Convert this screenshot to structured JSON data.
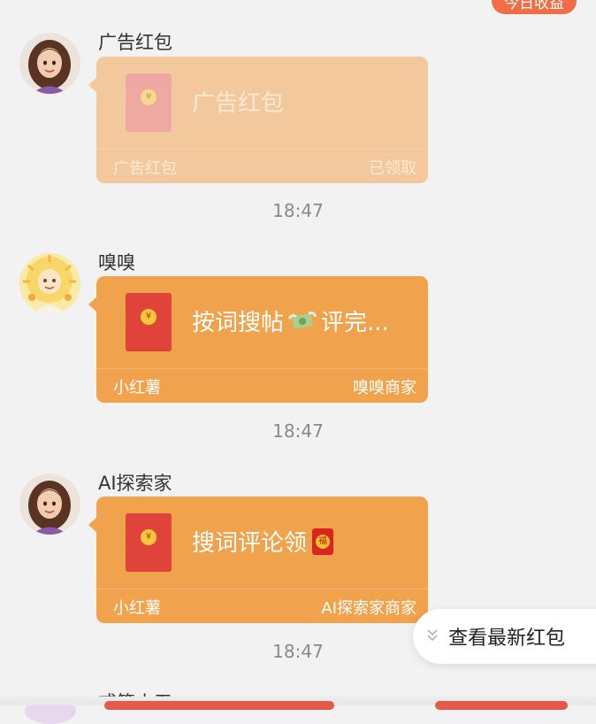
{
  "top_badge": "今日收益",
  "messages": [
    {
      "sender": "广告红包",
      "avatar": "woman-avatar-icon",
      "title": "广告红包",
      "footer_left": "广告红包",
      "footer_right": "已领取",
      "time": "18:47",
      "state": "claimed"
    },
    {
      "sender": "嗅嗅",
      "avatar": "sun-character-avatar-icon",
      "title_before": "按词搜帖",
      "title_after": "评完...",
      "title_emoji": "money-with-wings-icon",
      "footer_left": "小红薯",
      "footer_right": "嗅嗅商家",
      "time": "18:47"
    },
    {
      "sender": "AI探索家",
      "avatar": "woman-avatar-icon",
      "title": "搜词评论领",
      "title_emoji": "red-envelope-fu-icon",
      "footer_left": "小红薯",
      "footer_right": "AI探索家商家",
      "time": "18:47"
    }
  ],
  "partial_sender": "戒签小五",
  "view_newest_label": "查看最新红包",
  "colors": {
    "bubble": "#f0a24d",
    "bubble_claimed": "#f2c89c",
    "envelope": "#e0433a",
    "background": "#f2f2f2"
  }
}
